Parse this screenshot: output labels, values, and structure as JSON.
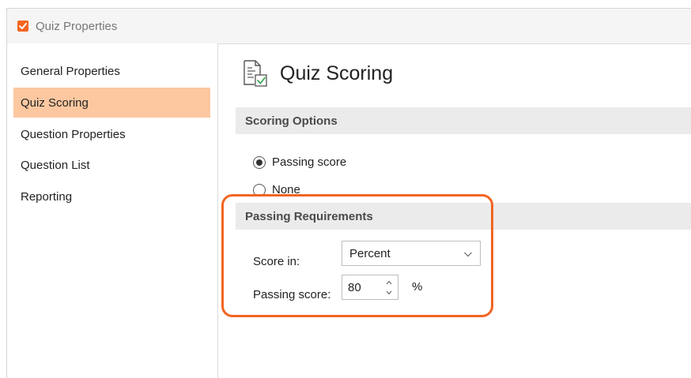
{
  "window": {
    "title": "Quiz Properties"
  },
  "sidebar": {
    "items": [
      {
        "label": "General Properties"
      },
      {
        "label": "Quiz Scoring",
        "active": true
      },
      {
        "label": "Question Properties"
      },
      {
        "label": "Question List"
      },
      {
        "label": "Reporting"
      }
    ]
  },
  "page": {
    "title": "Quiz Scoring",
    "icon": "checklist-document-icon"
  },
  "scoring_options": {
    "header": "Scoring Options",
    "options": [
      {
        "label": "Passing score",
        "selected": true
      },
      {
        "label": "None",
        "selected": false
      }
    ]
  },
  "passing_requirements": {
    "header": "Passing Requirements",
    "score_in_label": "Score in:",
    "score_in_value": "Percent",
    "passing_score_label": "Passing score:",
    "passing_score_value": "80",
    "unit": "%"
  },
  "colors": {
    "accent": "#f26522",
    "active_nav": "#fdc8a0",
    "section_bar": "#ebebeb",
    "checkmark": "#3aa655"
  }
}
